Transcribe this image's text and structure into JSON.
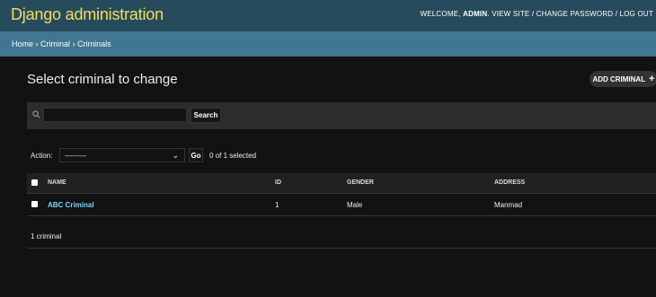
{
  "header": {
    "branding": "Django administration",
    "welcome": "WELCOME,",
    "username": "ADMIN",
    "view_site": "VIEW SITE",
    "change_password": "CHANGE PASSWORD",
    "log_out": "LOG OUT",
    "separator": "/"
  },
  "breadcrumbs": {
    "home": "Home",
    "app": "Criminal",
    "model": "Criminals",
    "sep": "›"
  },
  "content": {
    "title": "Select criminal to change",
    "add_button": "ADD CRIMINAL",
    "add_icon": "+"
  },
  "search": {
    "placeholder": "",
    "value": "",
    "button": "Search",
    "icon": "search-icon"
  },
  "actions": {
    "label": "Action:",
    "selected_value": "---------",
    "go_button": "Go",
    "selected_count": "0 of 1 selected"
  },
  "table": {
    "columns": [
      "NAME",
      "ID",
      "GENDER",
      "ADDRESS"
    ],
    "rows": [
      {
        "name": "ABC Criminal",
        "id": "1",
        "gender": "Male",
        "address": "Manmad"
      }
    ]
  },
  "result_count": "1 criminal",
  "colors": {
    "header_bg": "#264b5d",
    "breadcrumb_bg": "#417690",
    "branding": "#f5dd5d",
    "link": "#81d4fa",
    "page_bg": "#121212"
  }
}
